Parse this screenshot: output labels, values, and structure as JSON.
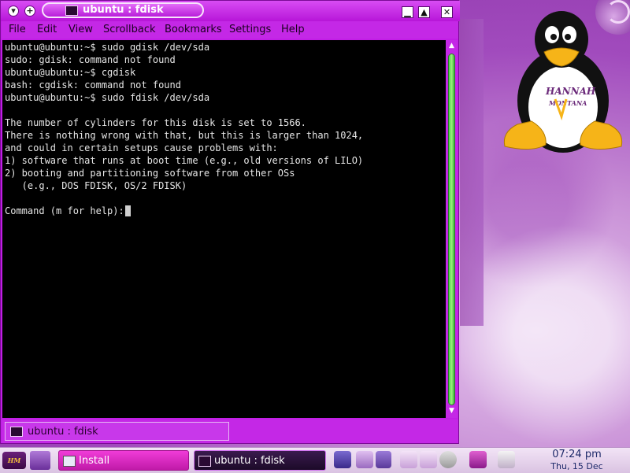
{
  "window": {
    "title": "ubuntu : fdisk",
    "menu": [
      "File",
      "Edit",
      "View",
      "Scrollback",
      "Bookmarks",
      "Settings",
      "Help"
    ],
    "tab_label": "ubuntu : fdisk"
  },
  "terminal": {
    "lines": [
      "ubuntu@ubuntu:~$ sudo gdisk /dev/sda",
      "sudo: gdisk: command not found",
      "ubuntu@ubuntu:~$ cgdisk",
      "bash: cgdisk: command not found",
      "ubuntu@ubuntu:~$ sudo fdisk /dev/sda",
      "",
      "The number of cylinders for this disk is set to 1566.",
      "There is nothing wrong with that, but this is larger than 1024,",
      "and could in certain setups cause problems with:",
      "1) software that runs at boot time (e.g., old versions of LILO)",
      "2) booting and partitioning software from other OSs",
      "   (e.g., DOS FDISK, OS/2 FDISK)",
      "",
      "Command (m for help): "
    ]
  },
  "scrollbar": {
    "position": 1.0
  },
  "desktop": {
    "mascot_text_line1": "HANNAH",
    "mascot_text_line2": "MONTANA"
  },
  "taskbar": {
    "tasks": [
      {
        "label": "Install",
        "active": false
      },
      {
        "label": "ubuntu : fdisk",
        "active": true
      }
    ],
    "clock": {
      "time": "07:24 pm",
      "date": "Thu, 15 Dec"
    }
  },
  "colors": {
    "window_accent": "#c21ee6",
    "terminal_bg": "#000000",
    "terminal_fg": "#e6e6e6",
    "scroll_thumb": "#6fe05f",
    "clock_text": "#1e2a6a"
  }
}
